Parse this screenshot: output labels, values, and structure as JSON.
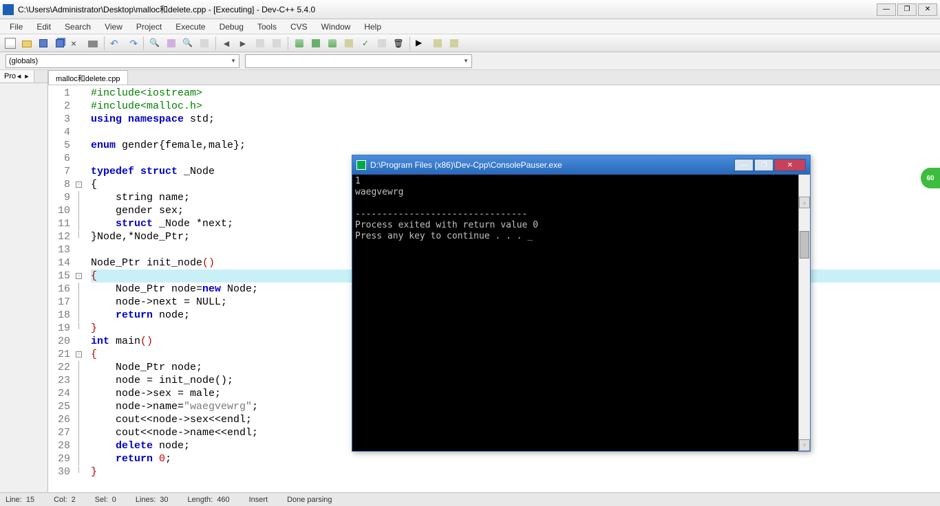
{
  "window": {
    "title": "C:\\Users\\Administrator\\Desktop\\malloc和delete.cpp - [Executing] - Dev-C++ 5.4.0",
    "min": "—",
    "max": "❐",
    "close": "✕"
  },
  "menu": {
    "file": "File",
    "edit": "Edit",
    "search": "Search",
    "view": "View",
    "project": "Project",
    "execute": "Execute",
    "debug": "Debug",
    "tools": "Tools",
    "cvs": "CVS",
    "window": "Window",
    "help": "Help"
  },
  "combo": {
    "globals": "(globals)",
    "empty": ""
  },
  "sideTab": {
    "project": "Pro"
  },
  "fileTab": "malloc和delete.cpp",
  "code": {
    "lines": [
      {
        "n": 1,
        "html": "<span class='pre'>#include&lt;iostream&gt;</span>"
      },
      {
        "n": 2,
        "html": "<span class='pre'>#include&lt;malloc.h&gt;</span>"
      },
      {
        "n": 3,
        "html": "<span class='kw'>using</span> <span class='kw'>namespace</span> std;"
      },
      {
        "n": 4,
        "html": ""
      },
      {
        "n": 5,
        "html": "<span class='kw'>enum</span> gender{female,male};"
      },
      {
        "n": 6,
        "html": ""
      },
      {
        "n": 7,
        "html": "<span class='kw'>typedef</span> <span class='kw'>struct</span> _Node"
      },
      {
        "n": 8,
        "html": "{",
        "fold": "box"
      },
      {
        "n": 9,
        "html": "    string name;",
        "fold": "line"
      },
      {
        "n": 10,
        "html": "    gender sex;",
        "fold": "line"
      },
      {
        "n": 11,
        "html": "    <span class='kw'>struct</span> _Node *next;",
        "fold": "line"
      },
      {
        "n": 12,
        "html": "}Node,*Node_Ptr;",
        "fold": "end"
      },
      {
        "n": 13,
        "html": ""
      },
      {
        "n": 14,
        "html": "Node_Ptr init_node<span class='op'>()</span>"
      },
      {
        "n": 15,
        "html": "<span class='op'>{</span>",
        "fold": "box",
        "hl": true
      },
      {
        "n": 16,
        "html": "    Node_Ptr node=<span class='kw'>new</span> Node;",
        "fold": "line"
      },
      {
        "n": 17,
        "html": "    node-&gt;next = NULL;",
        "fold": "line"
      },
      {
        "n": 18,
        "html": "    <span class='kw'>return</span> node;",
        "fold": "line"
      },
      {
        "n": 19,
        "html": "<span class='op'>}</span>",
        "fold": "end"
      },
      {
        "n": 20,
        "html": "<span class='kw'>int</span> main<span class='op'>()</span>"
      },
      {
        "n": 21,
        "html": "<span class='op'>{</span>",
        "fold": "box"
      },
      {
        "n": 22,
        "html": "    Node_Ptr node;",
        "fold": "line"
      },
      {
        "n": 23,
        "html": "    node = init_node();",
        "fold": "line"
      },
      {
        "n": 24,
        "html": "    node-&gt;sex = male;",
        "fold": "line"
      },
      {
        "n": 25,
        "html": "    node-&gt;name=<span class='str'>\"waegvewrg\"</span>;",
        "fold": "line"
      },
      {
        "n": 26,
        "html": "    cout&lt;&lt;node-&gt;sex&lt;&lt;endl;",
        "fold": "line"
      },
      {
        "n": 27,
        "html": "    cout&lt;&lt;node-&gt;name&lt;&lt;endl;",
        "fold": "line"
      },
      {
        "n": 28,
        "html": "    <span class='kw'>delete</span> node;",
        "fold": "line"
      },
      {
        "n": 29,
        "html": "    <span class='kw'>return</span> <span class='num'>0</span>;",
        "fold": "line"
      },
      {
        "n": 30,
        "html": "<span class='op'>}</span>",
        "fold": "end"
      }
    ]
  },
  "status": {
    "lineLabel": "Line:",
    "lineVal": "15",
    "colLabel": "Col:",
    "colVal": "2",
    "selLabel": "Sel:",
    "selVal": "0",
    "linesLabel": "Lines:",
    "linesVal": "30",
    "lenLabel": "Length:",
    "lenVal": "460",
    "mode": "Insert",
    "parse": "Done parsing"
  },
  "console": {
    "title": "D:\\Program Files (x86)\\Dev-Cpp\\ConsolePauser.exe",
    "line1": "1",
    "line2": "waegvewrg",
    "sep": "--------------------------------",
    "exit": "Process exited with return value 0",
    "prompt": "Press any key to continue . . . _"
  },
  "badge": "60"
}
